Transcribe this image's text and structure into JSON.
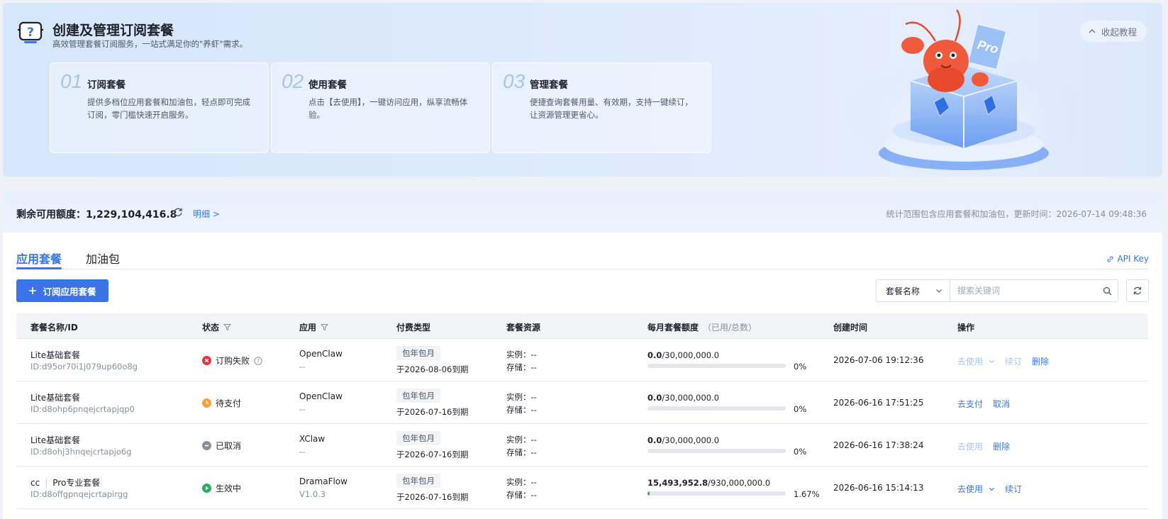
{
  "banner": {
    "title": "创建及管理订阅套餐",
    "subtitle": "高效管理套餐订阅服务，一站式满足你的\"养虾\"需求。",
    "collapse_label": "收起教程",
    "steps": [
      {
        "num": "01",
        "title": "订阅套餐",
        "desc": "提供多档位应用套餐和加油包，轻点即可完成订阅，零门槛快速开启服务。"
      },
      {
        "num": "02",
        "title": "使用套餐",
        "desc": "点击【去使用】，一键访问应用，纵享流畅体验。"
      },
      {
        "num": "03",
        "title": "管理套餐",
        "desc": "便捷查询套餐用量、有效期，支持一键续订，让资源管理更省心。"
      }
    ],
    "badge_text": "Pro"
  },
  "quota": {
    "label": "剩余可用额度：",
    "value": "1,229,104,416.8",
    "detail_link": "明细 >",
    "note": "统计范围包含应用套餐和加油包，更新时间：2026-07-14 09:48:36"
  },
  "tabs": [
    {
      "label": "应用套餐",
      "active": true
    },
    {
      "label": "加油包",
      "active": false
    }
  ],
  "api_key_label": "API Key",
  "toolbar": {
    "subscribe_label": "订阅应用套餐",
    "search_field": "套餐名称",
    "search_placeholder": "搜索关键词"
  },
  "table": {
    "headers": {
      "name": "套餐名称/ID",
      "status": "状态",
      "app": "应用",
      "pay": "付费类型",
      "resource": "套餐资源",
      "quota": "每月套餐额度",
      "quota_sub": "（已用/总数）",
      "created": "创建时间",
      "ops": "操作"
    },
    "rows": [
      {
        "name": "Lite基础套餐",
        "id": "ID:d95or70i1j079up60o8g",
        "status": "订购失败",
        "status_kind": "failed",
        "app": "OpenClaw",
        "app_version": "--",
        "pay_type": "包年包月",
        "expire": "于2026-08-06到期",
        "instance": "实例：--",
        "storage": "存储：--",
        "used": "0.0",
        "total": "/30,000,000.0",
        "percent_label": "0%",
        "percent": 0,
        "created": "2026-07-06 19:12:36",
        "ops": [
          {
            "label": "去使用",
            "disabled": true,
            "dropdown": true
          },
          {
            "label": "续订",
            "disabled": true
          },
          {
            "label": "删除",
            "disabled": false
          }
        ]
      },
      {
        "name": "Lite基础套餐",
        "id": "ID:d8ohp6pnqejcrtapjqp0",
        "status": "待支付",
        "status_kind": "pending",
        "app": "OpenClaw",
        "app_version": "--",
        "pay_type": "包年包月",
        "expire": "于2026-07-16到期",
        "instance": "实例：--",
        "storage": "存储：--",
        "used": "0.0",
        "total": "/30,000,000.0",
        "percent_label": "0%",
        "percent": 0,
        "created": "2026-06-16 17:51:25",
        "ops": [
          {
            "label": "去支付",
            "disabled": false
          },
          {
            "label": "取消",
            "disabled": false
          }
        ]
      },
      {
        "name": "Lite基础套餐",
        "id": "ID:d8ohj3hnqejcrtapjo6g",
        "status": "已取消",
        "status_kind": "cancelled",
        "app": "XClaw",
        "app_version": "--",
        "pay_type": "包年包月",
        "expire": "于2026-07-16到期",
        "instance": "实例：--",
        "storage": "存储：--",
        "used": "0.0",
        "total": "/30,000,000.0",
        "percent_label": "0%",
        "percent": 0,
        "created": "2026-06-16 17:38:24",
        "ops": [
          {
            "label": "去使用",
            "disabled": true
          },
          {
            "label": "删除",
            "disabled": false
          }
        ]
      },
      {
        "name_prefix": "cc",
        "name": "Pro专业套餐",
        "id": "ID:d8offgpnqejcrtapirgg",
        "status": "生效中",
        "status_kind": "active",
        "app": "DramaFlow",
        "app_version": "V1.0.3",
        "pay_type": "包年包月",
        "expire": "于2026-07-16到期",
        "instance": "实例：--",
        "storage": "存储：--",
        "used": "15,493,952.8",
        "total": "/930,000,000.0",
        "percent_label": "1.67%",
        "percent": 1.67,
        "created": "2026-06-16 15:14:13",
        "ops": [
          {
            "label": "去使用",
            "disabled": false,
            "dropdown": true
          },
          {
            "label": "续订",
            "disabled": false
          }
        ]
      }
    ]
  },
  "colors": {
    "primary": "#3a75e6",
    "failed": "#e8343b",
    "pending": "#f5a03a",
    "cancelled": "#8a8f99",
    "active": "#23b35f"
  }
}
